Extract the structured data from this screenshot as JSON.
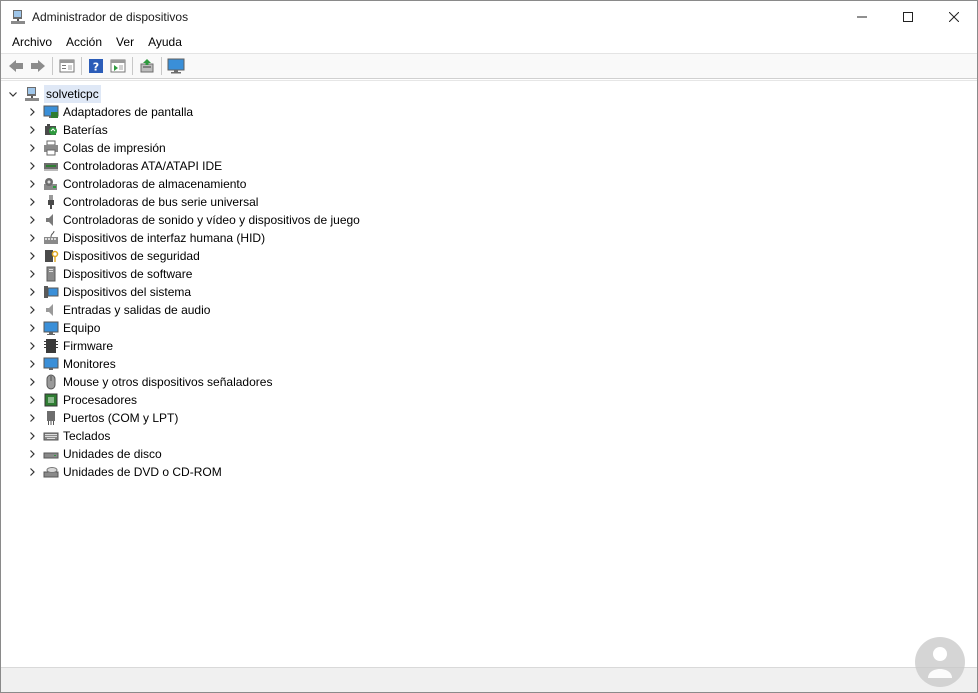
{
  "window": {
    "title": "Administrador de dispositivos"
  },
  "caption_buttons": {
    "minimize": "—",
    "maximize": "☐",
    "close": "✕"
  },
  "menu": [
    "Archivo",
    "Acción",
    "Ver",
    "Ayuda"
  ],
  "toolbar": [
    "back-icon",
    "forward-icon",
    "properties-view-icon",
    "help-icon",
    "scan-view-icon",
    "update-driver-icon",
    "monitor-icon"
  ],
  "tree": {
    "root": "solveticpc",
    "categories": [
      "Adaptadores de pantalla",
      "Baterías",
      "Colas de impresión",
      "Controladoras ATA/ATAPI IDE",
      "Controladoras de almacenamiento",
      "Controladoras de bus serie universal",
      "Controladoras de sonido y vídeo y dispositivos de juego",
      "Dispositivos de interfaz humana (HID)",
      "Dispositivos de seguridad",
      "Dispositivos de software",
      "Dispositivos del sistema",
      "Entradas y salidas de audio",
      "Equipo",
      "Firmware",
      "Monitores",
      "Mouse y otros dispositivos señaladores",
      "Procesadores",
      "Puertos (COM y LPT)",
      "Teclados",
      "Unidades de disco",
      "Unidades de DVD o CD-ROM"
    ],
    "category_icons": [
      "display-adapter-icon",
      "battery-icon",
      "printer-icon",
      "ide-controller-icon",
      "storage-controller-icon",
      "usb-icon",
      "sound-icon",
      "hid-icon",
      "security-device-icon",
      "software-device-icon",
      "system-device-icon",
      "audio-io-icon",
      "computer-icon",
      "firmware-icon",
      "monitor-icon",
      "mouse-icon",
      "processor-icon",
      "port-icon",
      "keyboard-icon",
      "disk-drive-icon",
      "dvd-drive-icon"
    ]
  },
  "colors": {
    "selection": "#dfe8f6",
    "monitor_blue": "#3a8fd8",
    "status_bar": "#f0f0f0"
  }
}
